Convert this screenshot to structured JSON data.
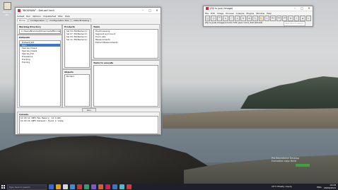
{
  "desktop": {
    "icon_label": "Recycle Bin"
  },
  "app": {
    "title": "\"BIODRAW\" - Deluxe! tech",
    "menus": [
      "Subset",
      "Run",
      "Options",
      "Unpublished",
      "Misc",
      "Help"
    ],
    "tabs": [
      "Home",
      "Configuration",
      "Configuration Tool",
      "Data Browsing"
    ],
    "working_directory": {
      "label": "Working Directory",
      "path": "C:/Users/Bhalinkadi/Downloads/Bitnl/data/sr/mt"
    },
    "datasets": {
      "label": "Datasets",
      "items": [
        "Dataset_001",
        "Main",
        "Species_Class1",
        "Species_Class2",
        "Species_Full",
        "Prevalence",
        "Tracking",
        "Training"
      ],
      "selected": "Main"
    },
    "products": {
      "label": "Products",
      "items": [
        "Sel 04 (HQ/Name=1)",
        "Sel 07 (HQ/Name=1)",
        "Sel 09 (HQ/Name=1)",
        "Sel 11 (HQ/Name=1)"
      ]
    },
    "objects": {
      "label": "Objects",
      "items": [
        "Borders"
      ]
    },
    "tasks": {
      "label": "Tasks",
      "items": [
        "Pre-Processing",
        "Segment and Count",
        "Track cells",
        "Measurements",
        "Extract Measurements"
      ]
    },
    "tasks_to_execute": {
      "label": "Tasks to execute"
    },
    "run_button": "Run",
    "console": {
      "label": "Console",
      "lines": [
        "14:29:14 INFO Max Memory: 12.1(GB)",
        "14:29:16 INFO Dataset: found 4 items"
      ]
    }
  },
  "fiji": {
    "title": "(Fiji Is Just) ImageJ",
    "menus": [
      "File",
      "Edit",
      "Image",
      "Process",
      "Analyze",
      "Plugins",
      "Window",
      "Help"
    ],
    "tools": [
      "□",
      "○",
      "⌒",
      "∿",
      "／",
      "+",
      "✦",
      "A",
      "🔍",
      "✋",
      "⌖",
      "Dev",
      "Stk",
      "LUT",
      "✎",
      "⁄",
      "≡",
      "»"
    ],
    "status": "(Fiji Is Just) ImageJ 2.9.0/1.53t; Java 1.8.0_322 [64-bit]",
    "search_placeholder": "Click here to search"
  },
  "watermark": {
    "line1": "Pro Educational Desktop",
    "line2": "Evaluation copy. Build"
  },
  "taskbar": {
    "search_placeholder": "Type here to search",
    "weather": "15°C Mostly cloudy",
    "time": "14:29",
    "date": "18/06/2024",
    "lang": "ENG",
    "icon_colors": [
      "#2f6ad8",
      "#e8a400",
      "#d8d8d8",
      "#3a8fd8",
      "#d03030",
      "#30a060",
      "#7a5ac8",
      "#e05a2a",
      "#d02050",
      "#2d7ad0",
      "#40c0d0",
      "#d33"
    ]
  }
}
